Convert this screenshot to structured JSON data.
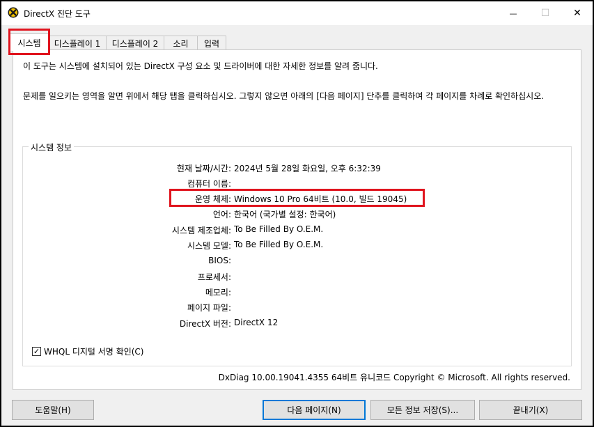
{
  "window": {
    "title": "DirectX 진단 도구",
    "minimize_glyph": "—",
    "maximize_glyph": "☐",
    "close_glyph": "✕"
  },
  "tabs": [
    {
      "label": "시스템",
      "active": true
    },
    {
      "label": "디스플레이 1",
      "active": false
    },
    {
      "label": "디스플레이 2",
      "active": false
    },
    {
      "label": "소리",
      "active": false
    },
    {
      "label": "입력",
      "active": false
    }
  ],
  "intro": {
    "line1": "이 도구는 시스템에 설치되어 있는 DirectX 구성 요소 및 드라이버에 대한 자세한 정보를 알려 줍니다.",
    "line2": "문제를 일으키는 영역을 알면 위에서 해당 탭을 클릭하십시오. 그렇지 않으면 아래의 [다음 페이지] 단추를 클릭하여 각 페이지를 차례로 확인하십시오."
  },
  "system_info": {
    "group_title": "시스템 정보",
    "rows": [
      {
        "label": "현재 날짜/시간:",
        "value": "2024년 5월 28일 화요일, 오후 6:32:39"
      },
      {
        "label": "컴퓨터 이름:",
        "value": ""
      },
      {
        "label": "운영 체제:",
        "value": "Windows 10 Pro 64비트 (10.0, 빌드 19045)"
      },
      {
        "label": "언어:",
        "value": "한국어 (국가별 설정: 한국어)"
      },
      {
        "label": "시스템 제조업체:",
        "value": "To Be Filled By O.E.M."
      },
      {
        "label": "시스템 모델:",
        "value": "To Be Filled By O.E.M."
      },
      {
        "label": "BIOS:",
        "value": ""
      },
      {
        "label": "프로세서:",
        "value": ""
      },
      {
        "label": "메모리:",
        "value": ""
      },
      {
        "label": "페이지 파일:",
        "value": ""
      },
      {
        "label": "DirectX 버전:",
        "value": "DirectX 12"
      }
    ]
  },
  "whql": {
    "label": "WHQL 디지털 서명 확인(C)",
    "checked": true,
    "check_glyph": "✓"
  },
  "footer_info": "DxDiag 10.00.19041.4355 64비트 유니코드  Copyright © Microsoft. All rights reserved.",
  "buttons": {
    "help": "도움말(H)",
    "next_page": "다음 페이지(N)",
    "save_all": "모든 정보 저장(S)...",
    "exit": "끝내기(X)"
  },
  "colors": {
    "highlight_box": "#e0141e",
    "default_button_border": "#0078d7"
  }
}
